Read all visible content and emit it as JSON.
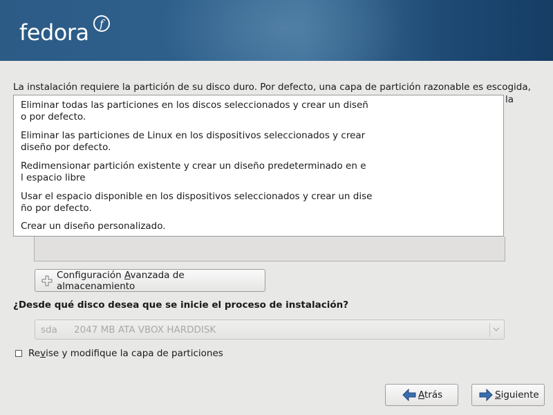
{
  "header": {
    "logo_text": "fedora",
    "logo_mark": "f"
  },
  "intro_text": "La instalación requiere la partición de su disco duro. Por defecto, una capa de partición razonable es escogida,",
  "intro_tail": "la",
  "layout_options": [
    {
      "line1": "Eliminar todas las particiones en los discos seleccionados y crear un diseñ",
      "line2": "o por defecto."
    },
    {
      "line1": "Eliminar las particiones de Linux en los dispositivos seleccionados y crear",
      "line2": "diseño por defecto."
    },
    {
      "line1": "Redimensionar partición existente y crear un diseño predeterminado en e",
      "line2": "l espacio libre"
    },
    {
      "line1": "Usar el espacio disponible en los dispositivos seleccionados y crear un dise",
      "line2": "ño por defecto."
    },
    {
      "line1": "Crear un diseño personalizado.",
      "line2": ""
    }
  ],
  "advanced_button": {
    "pre": "Configuración ",
    "accel": "A",
    "post": "vanzada de almacenamiento",
    "icon": "plus-icon"
  },
  "boot_question": "¿Desde qué disco desea que se inicie el proceso de instalación?",
  "boot_disk": {
    "name": "sda",
    "description": "2047 MB ATA VBOX HARDDISK"
  },
  "review_checkbox": {
    "pre": "Re",
    "accel": "v",
    "post": "ise y modifique la capa de particiones",
    "checked": false
  },
  "nav": {
    "back": {
      "accel": "A",
      "rest": "trás",
      "icon": "back-arrow-icon"
    },
    "next": {
      "accel": "S",
      "rest": "iguiente",
      "icon": "forward-arrow-icon"
    }
  },
  "colors": {
    "banner": "#2e5f8b",
    "arrow": "#3a6fb0"
  }
}
